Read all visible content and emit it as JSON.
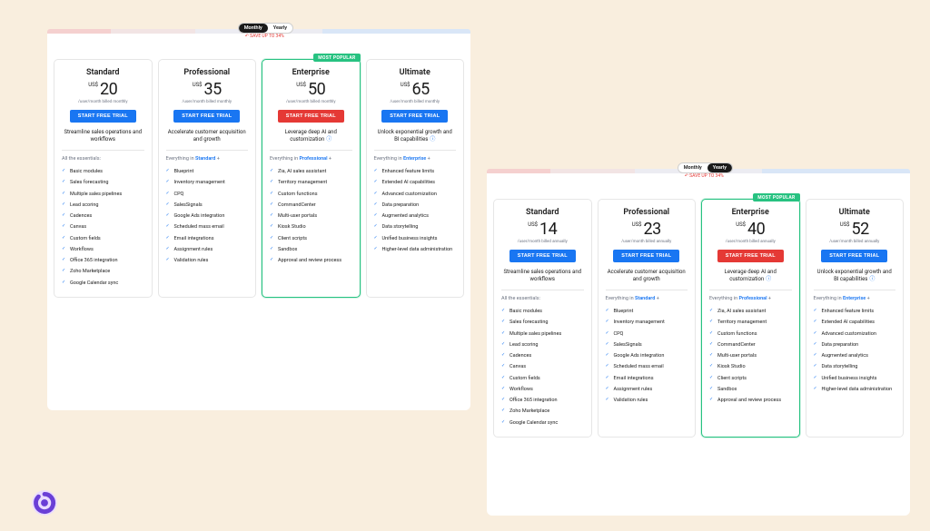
{
  "toggle": {
    "monthly": "Monthly",
    "yearly": "Yearly",
    "save": "SAVE UP TO 34%"
  },
  "shared": {
    "currency": "US$",
    "cta": "START FREE TRIAL",
    "billingMonthly": "/user/month billed monthly",
    "billingYearly": "/user/month billed annually",
    "badge": "MOST POPULAR"
  },
  "headings": {
    "essentials": "All the essentials:",
    "standard": "Everything in Standard +",
    "professional": "Everything in Professional +",
    "enterprise": "Everything in Enterprise +"
  },
  "plans": {
    "standard": {
      "name": "Standard",
      "tagline": "Streamline sales operations and workflows",
      "features": [
        "Basic modules",
        "Sales forecasting",
        "Multiple sales pipelines",
        "Lead scoring",
        "Cadences",
        "Canvas",
        "Custom fields",
        "Workflows",
        "Office 365 integration",
        "Zoho Marketplace",
        "Google Calendar sync"
      ]
    },
    "professional": {
      "name": "Professional",
      "tagline": "Accelerate customer acquisition and growth",
      "features": [
        "Blueprint",
        "Inventory management",
        "CPQ",
        "SalesSignals",
        "Google Ads integration",
        "Scheduled mass email",
        "Email integrations",
        "Assignment rules",
        "Validation rules"
      ]
    },
    "enterprise": {
      "name": "Enterprise",
      "tagline": "Leverage deep AI and customization",
      "features": [
        "Zia, AI sales assistant",
        "Territory management",
        "Custom functions",
        "CommandCenter",
        "Multi-user portals",
        "Kiosk Studio",
        "Client scripts",
        "Sandbox",
        "Approval and review process"
      ]
    },
    "ultimate": {
      "name": "Ultimate",
      "tagline": "Unlock exponential growth and BI capabilities",
      "features": [
        "Enhanced feature limits",
        "Extended AI capabilities",
        "Advanced customization",
        "Data preparation",
        "Augmented analytics",
        "Data storytelling",
        "Unified business insights",
        "Higher-level data administration"
      ]
    }
  },
  "prices": {
    "monthly": {
      "standard": "20",
      "professional": "35",
      "enterprise": "50",
      "ultimate": "65"
    },
    "yearly": {
      "standard": "14",
      "professional": "23",
      "enterprise": "40",
      "ultimate": "52"
    }
  }
}
